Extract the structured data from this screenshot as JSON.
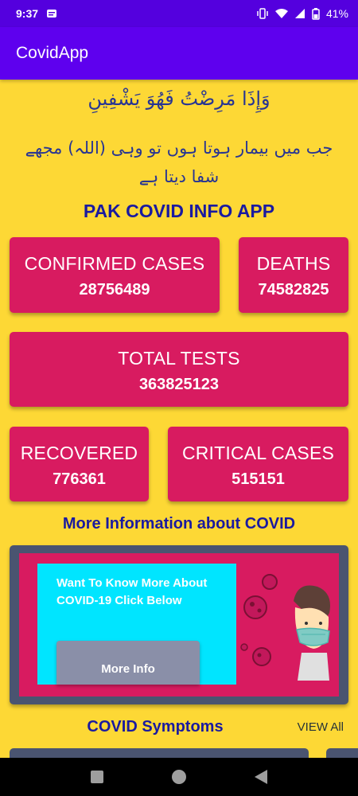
{
  "status_bar": {
    "time": "9:37",
    "battery": "41%"
  },
  "app_bar": {
    "title": "CovidApp"
  },
  "verse": "وَإِذَا مَرِضْتُ فَهُوَ يَشْفِينِ",
  "urdu_text": "جب میں بیمار ہوتا ہوں تو وہی (اللہ) مجھے شفا دیتا ہے",
  "heading": "PAK COVID INFO APP",
  "stats": {
    "confirmed": {
      "label": "CONFIRMED CASES",
      "value": "28756489"
    },
    "deaths": {
      "label": "DEATHS",
      "value": "74582825"
    },
    "total_tests": {
      "label": "TOTAL TESTS",
      "value": "363825123"
    },
    "recovered": {
      "label": "RECOVERED",
      "value": "776361"
    },
    "critical": {
      "label": "CRITICAL CASES",
      "value": "515151"
    }
  },
  "more_info_section": {
    "title": "More Information about COVID",
    "banner_text": "Want To Know More About COVID-19 Click Below",
    "button_label": "More Info"
  },
  "symptoms": {
    "title": "COVID Symptoms",
    "view_all": "VIEW All"
  },
  "colors": {
    "primary": "#5e00ee",
    "background": "#fdd835",
    "card": "#d81b60",
    "heading": "#1a1aa0",
    "banner_box": "#00e5ff"
  },
  "icons": [
    "notification-icon",
    "vibrate-icon",
    "wifi-icon",
    "signal-icon",
    "battery-icon",
    "nav-recents-icon",
    "nav-home-icon",
    "nav-back-icon"
  ]
}
